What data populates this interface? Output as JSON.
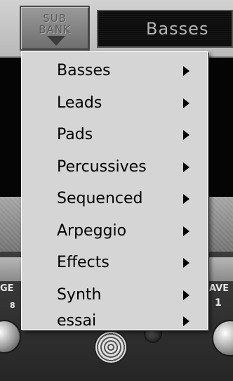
{
  "subbank_button": {
    "line1": "SUB",
    "line2": "BANK",
    "arrow_icon": "down-triangle-icon"
  },
  "bank_display": {
    "value": "Basses"
  },
  "menu": {
    "items": [
      {
        "label": "Basses",
        "has_submenu": true
      },
      {
        "label": "Leads",
        "has_submenu": true
      },
      {
        "label": "Pads",
        "has_submenu": true
      },
      {
        "label": "Percussives",
        "has_submenu": true
      },
      {
        "label": "Sequenced",
        "has_submenu": true
      },
      {
        "label": "Arpeggio",
        "has_submenu": true
      },
      {
        "label": "Effects",
        "has_submenu": true
      },
      {
        "label": "Synth",
        "has_submenu": true
      },
      {
        "label": "essai",
        "has_submenu": true
      }
    ],
    "submenu_icon": "chevron-right-icon"
  },
  "background_labels": {
    "left_top": "GE",
    "left_bottom": "8",
    "right_top": "AVE",
    "right_bottom": "1"
  },
  "colors": {
    "menu_background": "#d5d5d5",
    "menu_text": "#000000",
    "display_text": "#b5b5b5"
  }
}
